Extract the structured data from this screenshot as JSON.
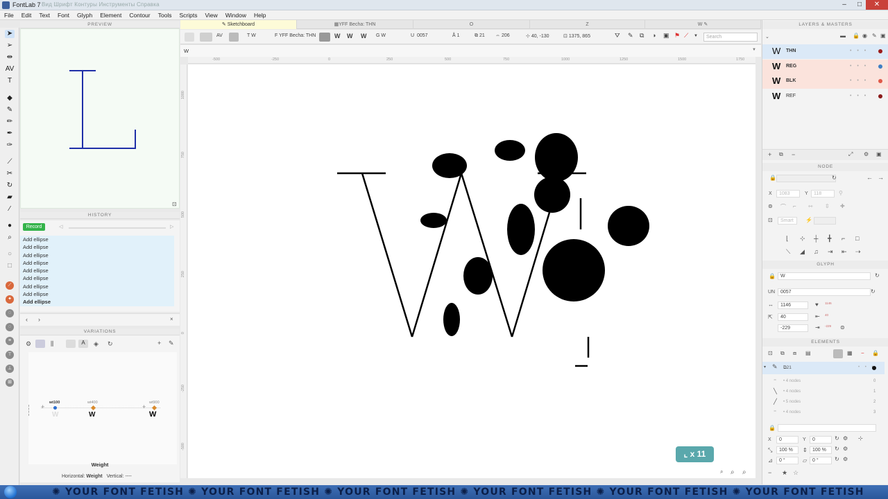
{
  "window": {
    "title": "FontLab 7",
    "ghost_menu": "Вид  Шрифт  Контуры  Инструменты  Справка",
    "controls": [
      "–",
      "□",
      "✕"
    ]
  },
  "menu": [
    "File",
    "Edit",
    "Text",
    "Font",
    "Glyph",
    "Element",
    "Contour",
    "Tools",
    "Scripts",
    "View",
    "Window",
    "Help"
  ],
  "preview": {
    "title": "PREVIEW"
  },
  "history": {
    "title": "HISTORY",
    "record_label": "Record",
    "items": [
      "Add ellipse",
      "Add ellipse",
      "Add ellipse",
      "Add ellipse",
      "Add ellipse",
      "Add ellipse",
      "Add ellipse",
      "Add ellipse",
      "Add ellipse"
    ]
  },
  "variations": {
    "title": "VARIATIONS",
    "masters": [
      {
        "label": "wt100",
        "glyph": "W",
        "color": "#2d6fd0"
      },
      {
        "label": "wt400",
        "glyph": "W",
        "color": "#d98a2c"
      },
      {
        "label": "wt900",
        "glyph": "W",
        "color": "#d98a2c"
      }
    ],
    "axis_name": "Weight",
    "horizontal_label": "Horizontal:",
    "horizontal_value": "Weight",
    "vertical_label": "Vertical:",
    "vertical_value": "----"
  },
  "tabs": [
    {
      "label": "Sketchboard",
      "active": true
    },
    {
      "label": "YFF Becha: THN",
      "active": false
    },
    {
      "label": "O",
      "active": false
    },
    {
      "label": "Z",
      "active": false
    },
    {
      "label": "W",
      "active": false
    }
  ],
  "propbar": {
    "t_label": "T  W",
    "font_layer": "F  YFF Becha: THN",
    "g_label": "G  W",
    "unicode_prefix": "U",
    "unicode": "0057",
    "a_label": "Å  1",
    "count": "21",
    "width": "206",
    "coords": "40, -130",
    "coords2": "1375, 865",
    "search_placeholder": "Search"
  },
  "glyph_name_field": "W",
  "ruler": {
    "top_ticks": [
      "-500",
      "-250",
      "0",
      "250",
      "500",
      "750",
      "1000",
      "1250",
      "1500",
      "1750"
    ],
    "left_ticks": [
      "1000",
      "750",
      "500",
      "250",
      "0",
      "-250",
      "-500"
    ]
  },
  "canvas": {
    "count_badge": "x 11"
  },
  "layers": {
    "title": "LAYERS & MASTERS",
    "rows": [
      {
        "name": "THN",
        "glyph": "W",
        "color": "#9b1c1c",
        "bg": "#dbe9f7"
      },
      {
        "name": "REG",
        "glyph": "W",
        "color": "#3f7fc4",
        "bg": "#fbe3dc"
      },
      {
        "name": "BLK",
        "glyph": "W",
        "color": "#e05a4a",
        "bg": "#fbe3dc"
      },
      {
        "name": "REF",
        "glyph": "W",
        "color": "#8a1a1a",
        "bg": "#f7f7f7"
      }
    ]
  },
  "node": {
    "title": "NODE",
    "x_label": "X",
    "x_value": "1083",
    "y_label": "Y",
    "y_value": "118",
    "smart": "Smart"
  },
  "glyph": {
    "title": "GLYPH",
    "name": "W",
    "un_label": "UN",
    "unicode": "0057",
    "advance": "1146",
    "lsb": "40",
    "rsb": "-229",
    "small_a": "1146",
    "small_b": "40",
    "small_c": "-229"
  },
  "elements": {
    "title": "ELEMENTS",
    "element_label": "21",
    "rows": [
      {
        "text": "4 nodes",
        "idx": "0"
      },
      {
        "text": "4 nodes",
        "idx": "1"
      },
      {
        "text": "5 nodes",
        "idx": "2"
      },
      {
        "text": "4 nodes",
        "idx": "3"
      }
    ],
    "x_label": "X",
    "x_value": "0",
    "y_label": "Y",
    "y_value": "0",
    "sx": "100 %",
    "sy": "100 %",
    "rot": "0 °",
    "slant": "0 °"
  },
  "taskbar": {
    "marquee": "✺ YOUR FONT FETISH ✺ YOUR FONT FETISH ✺ YOUR FONT FETISH ✺ YOUR FONT FETISH ✺ YOUR FONT FETISH ✺ YOUR FONT FETISH"
  }
}
